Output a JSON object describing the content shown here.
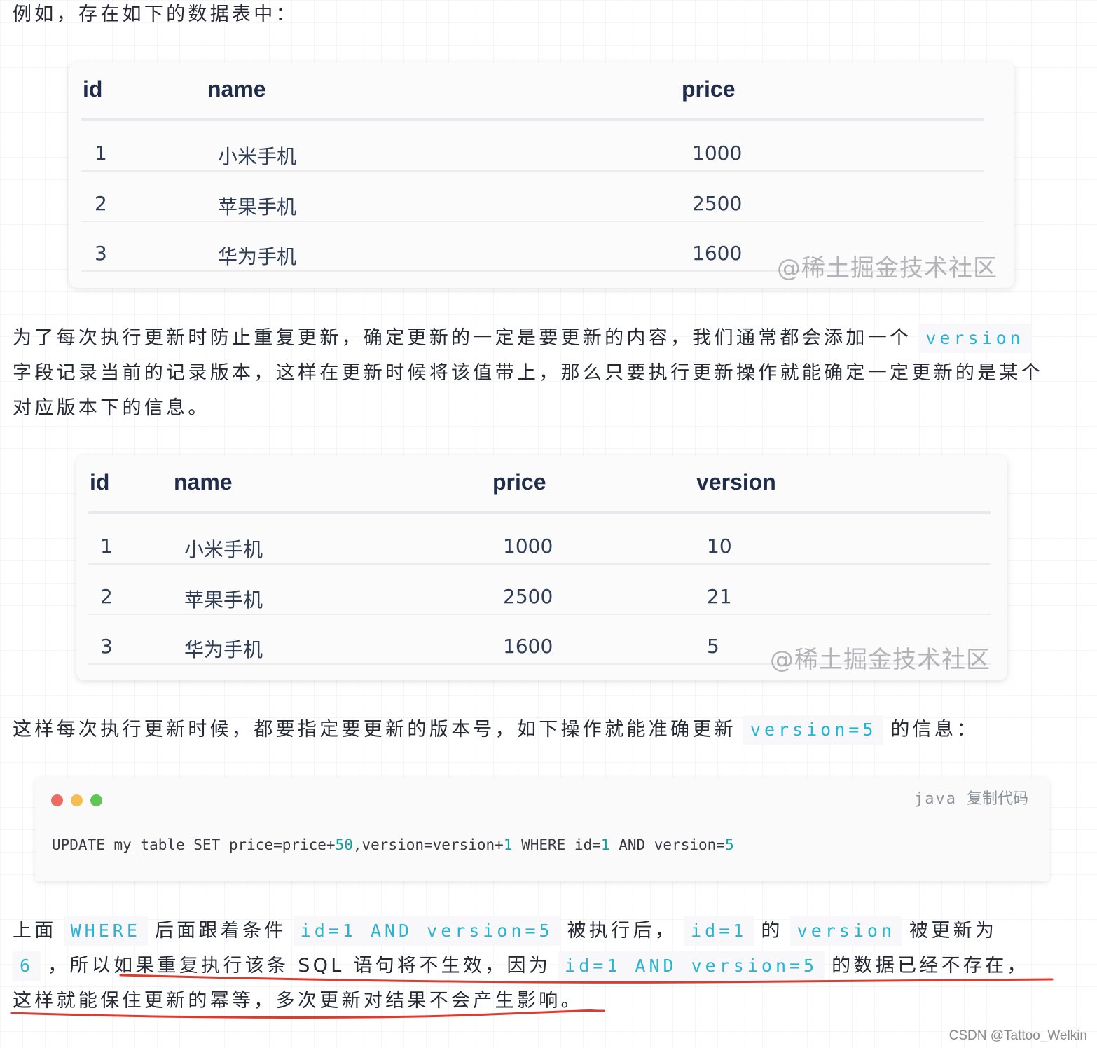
{
  "intro": "例如，存在如下的数据表中：",
  "table1": {
    "headers": [
      "id",
      "name",
      "price"
    ],
    "rows": [
      [
        "1",
        "小米手机",
        "1000"
      ],
      [
        "2",
        "苹果手机",
        "2500"
      ],
      [
        "3",
        "华为手机",
        "1600"
      ]
    ],
    "watermark": "@稀土掘金技术社区"
  },
  "para2": {
    "line1": "为了每次执行更新时防止重复更新，确定更新的一定是要更新的内容，我们通常都会添加一个",
    "code1": "version",
    "line2": "字段记录当前的记录版本，这样在更新时候将该值带上，那么只要执行更新操作就能确定一定更新的是某个",
    "line3": "对应版本下的信息。"
  },
  "table2": {
    "headers": [
      "id",
      "name",
      "price",
      "version"
    ],
    "rows": [
      [
        "1",
        "小米手机",
        "1000",
        "10"
      ],
      [
        "2",
        "苹果手机",
        "2500",
        "21"
      ],
      [
        "3",
        "华为手机",
        "1600",
        "5"
      ]
    ],
    "watermark": "@稀土掘金技术社区"
  },
  "para3": {
    "text": "这样每次执行更新时候，都要指定要更新的版本号，如下操作就能准确更新",
    "code": "version=5",
    "tail": "的信息："
  },
  "code_block": {
    "lang": "java",
    "copy_label": "复制代码",
    "tokens": [
      "UPDATE my_table SET price=price+",
      "50",
      ",version=version+",
      "1",
      " WHERE id=",
      "1",
      " AND version=",
      "5"
    ],
    "dots": [
      "#ec6a5e",
      "#f4bf4f",
      "#61c554"
    ]
  },
  "para4": {
    "t1": "上面",
    "c1": "WHERE",
    "t2": "后面跟着条件",
    "c2": "id=1 AND version=5",
    "t3": "被执行后，",
    "c3": "id=1",
    "t4": "的",
    "c4": "version",
    "t5": "被更新为",
    "c5": "6",
    "t6": "，所以如果重复执行该条 SQL 语句将不生效，因为",
    "c6": "id=1 AND version=5",
    "t7": "的数据已经不存在，",
    "t8": "这样就能保住更新的幂等，多次更新对结果不会产生影响。"
  },
  "footer": "CSDN @Tattoo_Welkin",
  "colors": {
    "inline_code": "#28b5d3",
    "underline": "#e03a2e",
    "table_header": "#1f2d4a"
  }
}
